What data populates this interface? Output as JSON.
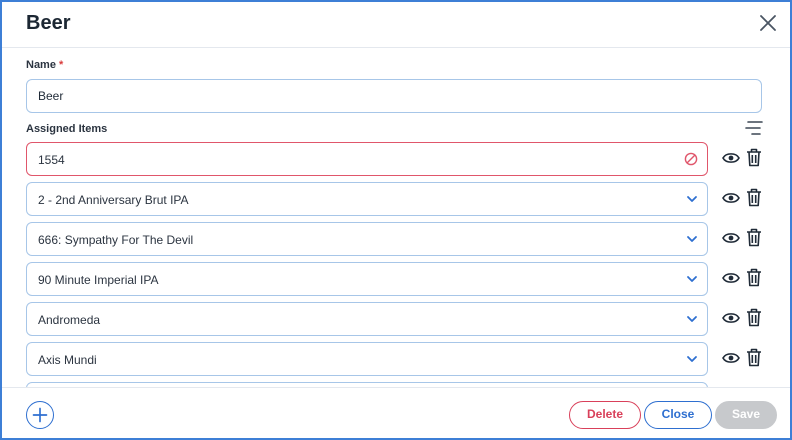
{
  "dialog": {
    "title": "Beer",
    "close_icon": "close-icon"
  },
  "name_field": {
    "label": "Name",
    "required_marker": "*",
    "value": "Beer"
  },
  "assigned": {
    "label": "Assigned Items",
    "sort_icon": "sort-lines-icon",
    "items": [
      {
        "text": "1554",
        "state": "error",
        "indicator_icon": "blocked-icon"
      },
      {
        "text": "2 - 2nd Anniversary Brut IPA",
        "state": "normal",
        "indicator_icon": "chevron-down-icon"
      },
      {
        "text": "666: Sympathy For The Devil",
        "state": "normal",
        "indicator_icon": "chevron-down-icon"
      },
      {
        "text": "90 Minute Imperial IPA",
        "state": "normal",
        "indicator_icon": "chevron-down-icon"
      },
      {
        "text": "Andromeda",
        "state": "normal",
        "indicator_icon": "chevron-down-icon"
      },
      {
        "text": "Axis Mundi",
        "state": "normal",
        "indicator_icon": "chevron-down-icon"
      },
      {
        "text": "",
        "state": "normal",
        "indicator_icon": "chevron-down-icon"
      }
    ],
    "row_icons": [
      "eye-icon",
      "trash-icon"
    ]
  },
  "footer": {
    "add_icon": "plus-circle-icon",
    "delete_label": "Delete",
    "close_label": "Close",
    "save_label": "Save"
  },
  "colors": {
    "accent": "#2e6fd0",
    "danger": "#d9405a",
    "disabled": "#c7c9cc",
    "field_border": "#a7c6e8",
    "frame": "#3d7fd6"
  }
}
